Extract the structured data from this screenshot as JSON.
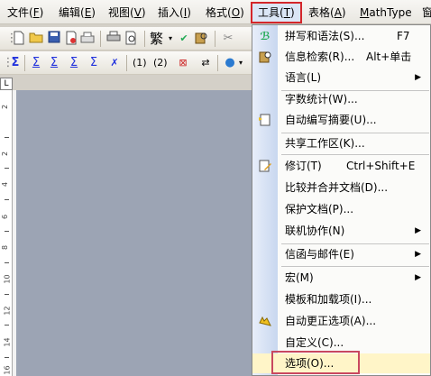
{
  "menubar": {
    "items": [
      {
        "label": "文件(",
        "key": "F",
        "end": ")"
      },
      {
        "label": "编辑(",
        "key": "E",
        "end": ")"
      },
      {
        "label": "视图(",
        "key": "V",
        "end": ")"
      },
      {
        "label": "插入(",
        "key": "I",
        "end": ")"
      },
      {
        "label": "格式(",
        "key": "O",
        "end": ")"
      },
      {
        "label": "工具(",
        "key": "T",
        "end": ")"
      },
      {
        "label": "表格(",
        "key": "A",
        "end": ")"
      },
      {
        "label": "",
        "key": "M",
        "end": "athType"
      },
      {
        "label": "窗",
        "key": "",
        "end": ""
      }
    ]
  },
  "toolbar1": {
    "traditional_label": "繁"
  },
  "toolbar2": {
    "labels": [
      "(1)",
      "(2)"
    ]
  },
  "ruler": {
    "corner": "L",
    "ticks": [
      "2",
      "·",
      "2",
      "·",
      "4",
      "·",
      "6",
      "·",
      "8",
      "·",
      "10",
      "·",
      "12",
      "·",
      "14",
      "·",
      "16"
    ]
  },
  "tools_menu": {
    "items": [
      {
        "label": "拼写和语法(S)...",
        "shortcut": "F7",
        "icon": "spelling-icon",
        "submenu": false
      },
      {
        "label": "信息检索(R)...",
        "shortcut": "Alt+单击",
        "icon": "research-icon",
        "submenu": false
      },
      {
        "label": "语言(L)",
        "shortcut": "",
        "icon": "",
        "submenu": true
      },
      {
        "label": "字数统计(W)...",
        "shortcut": "",
        "icon": "",
        "submenu": false
      },
      {
        "label": "自动编写摘要(U)...",
        "shortcut": "",
        "icon": "autosummarize-icon",
        "submenu": false
      },
      {
        "label": "共享工作区(K)...",
        "shortcut": "",
        "icon": "",
        "submenu": false
      },
      {
        "label": "修订(T)",
        "shortcut": "Ctrl+Shift+E",
        "icon": "track-changes-icon",
        "submenu": false
      },
      {
        "label": "比较并合并文档(D)...",
        "shortcut": "",
        "icon": "",
        "submenu": false
      },
      {
        "label": "保护文档(P)...",
        "shortcut": "",
        "icon": "",
        "submenu": false
      },
      {
        "label": "联机协作(N)",
        "shortcut": "",
        "icon": "",
        "submenu": true
      },
      {
        "label": "信函与邮件(E)",
        "shortcut": "",
        "icon": "",
        "submenu": true
      },
      {
        "label": "宏(M)",
        "shortcut": "",
        "icon": "",
        "submenu": true
      },
      {
        "label": "模板和加载项(I)...",
        "shortcut": "",
        "icon": "",
        "submenu": false
      },
      {
        "label": "自动更正选项(A)...",
        "shortcut": "",
        "icon": "autocorrect-icon",
        "submenu": false
      },
      {
        "label": "自定义(C)...",
        "shortcut": "",
        "icon": "",
        "submenu": false
      },
      {
        "label": "选项(O)...",
        "shortcut": "",
        "icon": "",
        "submenu": false
      }
    ]
  },
  "colors": {
    "highlight_border": "#d4262a",
    "options_highlight": "#fff5c8",
    "doc_background": "#9ca4b4"
  }
}
